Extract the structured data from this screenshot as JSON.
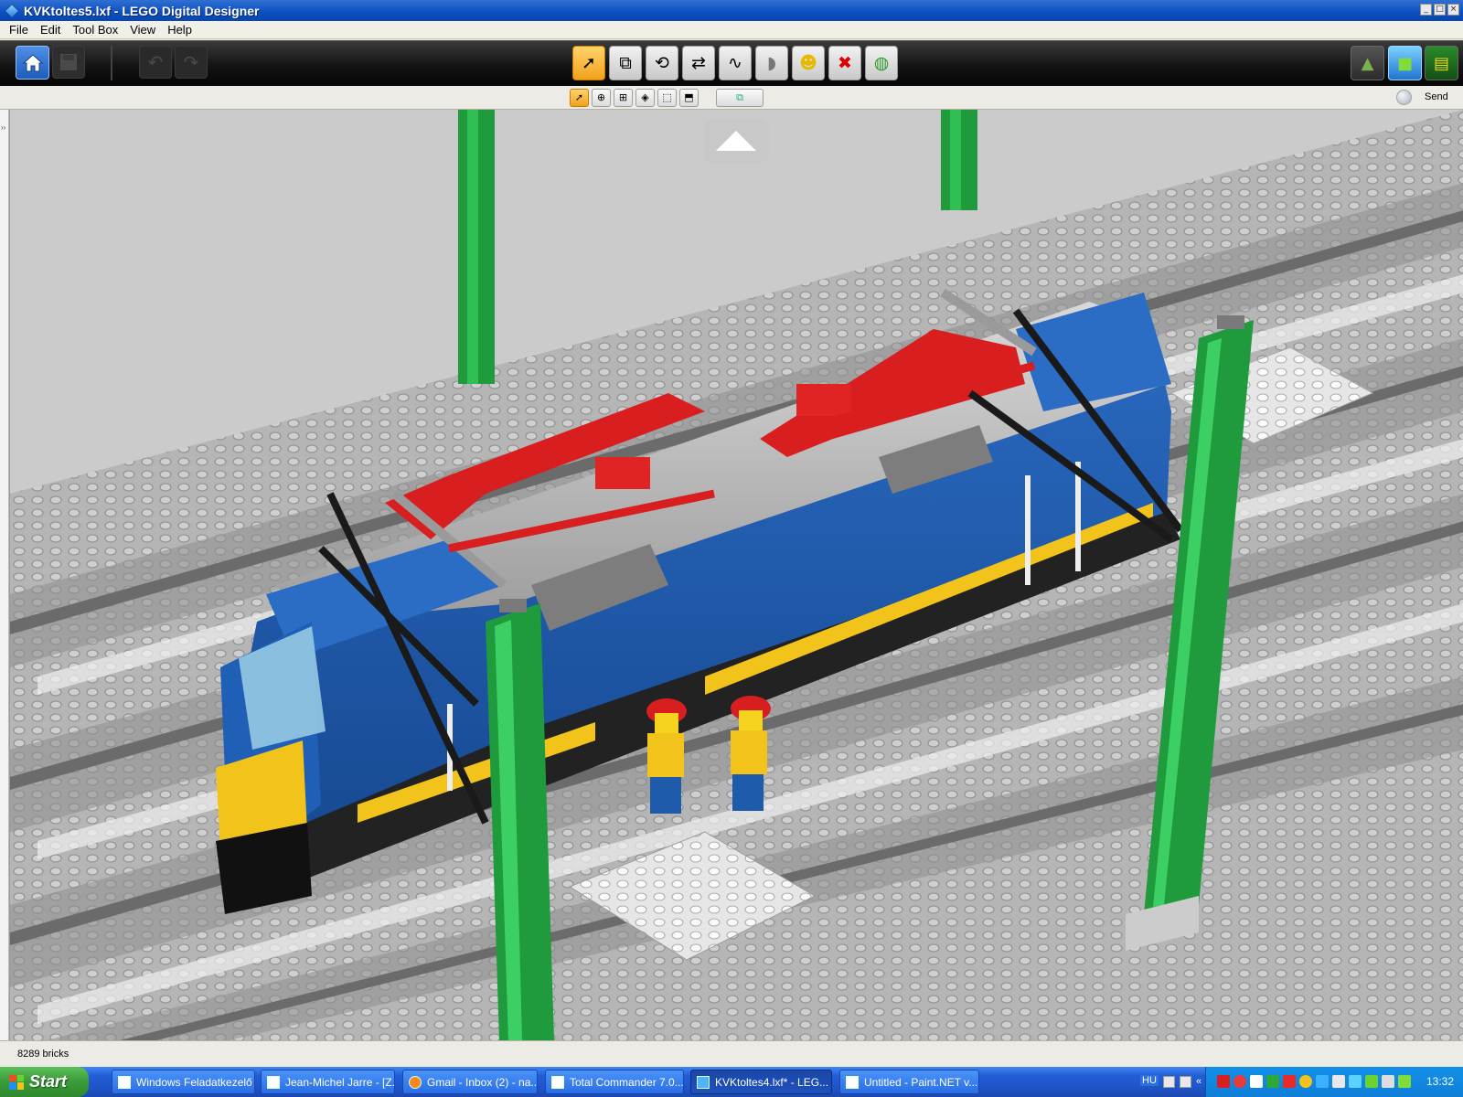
{
  "window": {
    "title": "KVKtoltes5.lxf - LEGO Digital Designer",
    "controls": [
      "_",
      "□",
      "×"
    ]
  },
  "menu": {
    "items": [
      "File",
      "Edit",
      "Tool Box",
      "View",
      "Help"
    ]
  },
  "toolbar": {
    "home_icon": "home-icon",
    "tools": [
      {
        "name": "select-tool",
        "glyph": "➚"
      },
      {
        "name": "clone-tool",
        "glyph": "⧉"
      },
      {
        "name": "hinge-tool",
        "glyph": "⟲"
      },
      {
        "name": "hinge-align-tool",
        "glyph": "⇄"
      },
      {
        "name": "flex-tool",
        "glyph": "∿"
      },
      {
        "name": "paint-tool",
        "glyph": "🖌"
      },
      {
        "name": "decoration-tool",
        "glyph": "☺"
      },
      {
        "name": "delete-tool",
        "glyph": "✖"
      },
      {
        "name": "hide-tool",
        "glyph": "◍"
      }
    ],
    "modes": [
      "build-mode",
      "view-mode",
      "building-guide-mode"
    ]
  },
  "subbar": {
    "send_label": "Send",
    "select_modes": [
      "➚",
      "⊕",
      "⊞",
      "◈",
      "⬚",
      "⬒"
    ]
  },
  "viewport": {
    "accent_colors": {
      "locomotive_blue": "#1e5cab",
      "stripe_yellow": "#f2c31a",
      "pantograph_red": "#d81e1e",
      "pole_green": "#1f9a3c",
      "baseplate_gray": "#a9a9a9"
    }
  },
  "status": {
    "brick_count": "8289 bricks"
  },
  "taskbar": {
    "start_label": "Start",
    "tasks": [
      {
        "label": "Windows Feladatkezelő",
        "active": false
      },
      {
        "label": "Jean-Michel Jarre - [Z...",
        "active": false
      },
      {
        "label": "Gmail - Inbox (2) - na...",
        "active": false
      },
      {
        "label": "Total Commander 7.0...",
        "active": false
      },
      {
        "label": "KVKtoltes4.lxf* - LEG...",
        "active": true
      },
      {
        "label": "Untitled - Paint.NET v...",
        "active": false
      }
    ],
    "language": "HU",
    "clock": "13:32"
  }
}
